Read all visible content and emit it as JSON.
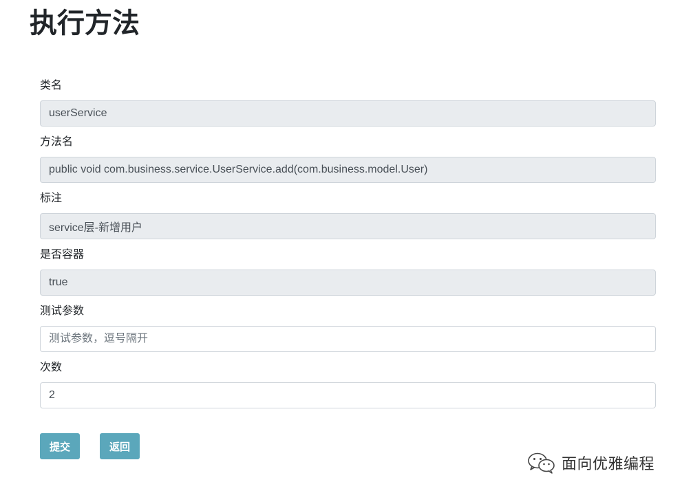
{
  "page": {
    "title": "执行方法"
  },
  "form": {
    "class_name": {
      "label": "类名",
      "value": "userService"
    },
    "method_name": {
      "label": "方法名",
      "value": "public void com.business.service.UserService.add(com.business.model.User)"
    },
    "annotation": {
      "label": "标注",
      "value": "service层-新增用户"
    },
    "is_container": {
      "label": "是否容器",
      "value": "true"
    },
    "test_params": {
      "label": "测试参数",
      "value": "",
      "placeholder": "测试参数，逗号隔开"
    },
    "count": {
      "label": "次数",
      "value": "2"
    }
  },
  "buttons": {
    "submit_label": "提交",
    "back_label": "返回"
  },
  "watermark": {
    "icon": "wechat-icon",
    "text": "面向优雅编程"
  },
  "colors": {
    "button": "#5ba7bb",
    "readonly_bg": "#e9ecef"
  }
}
